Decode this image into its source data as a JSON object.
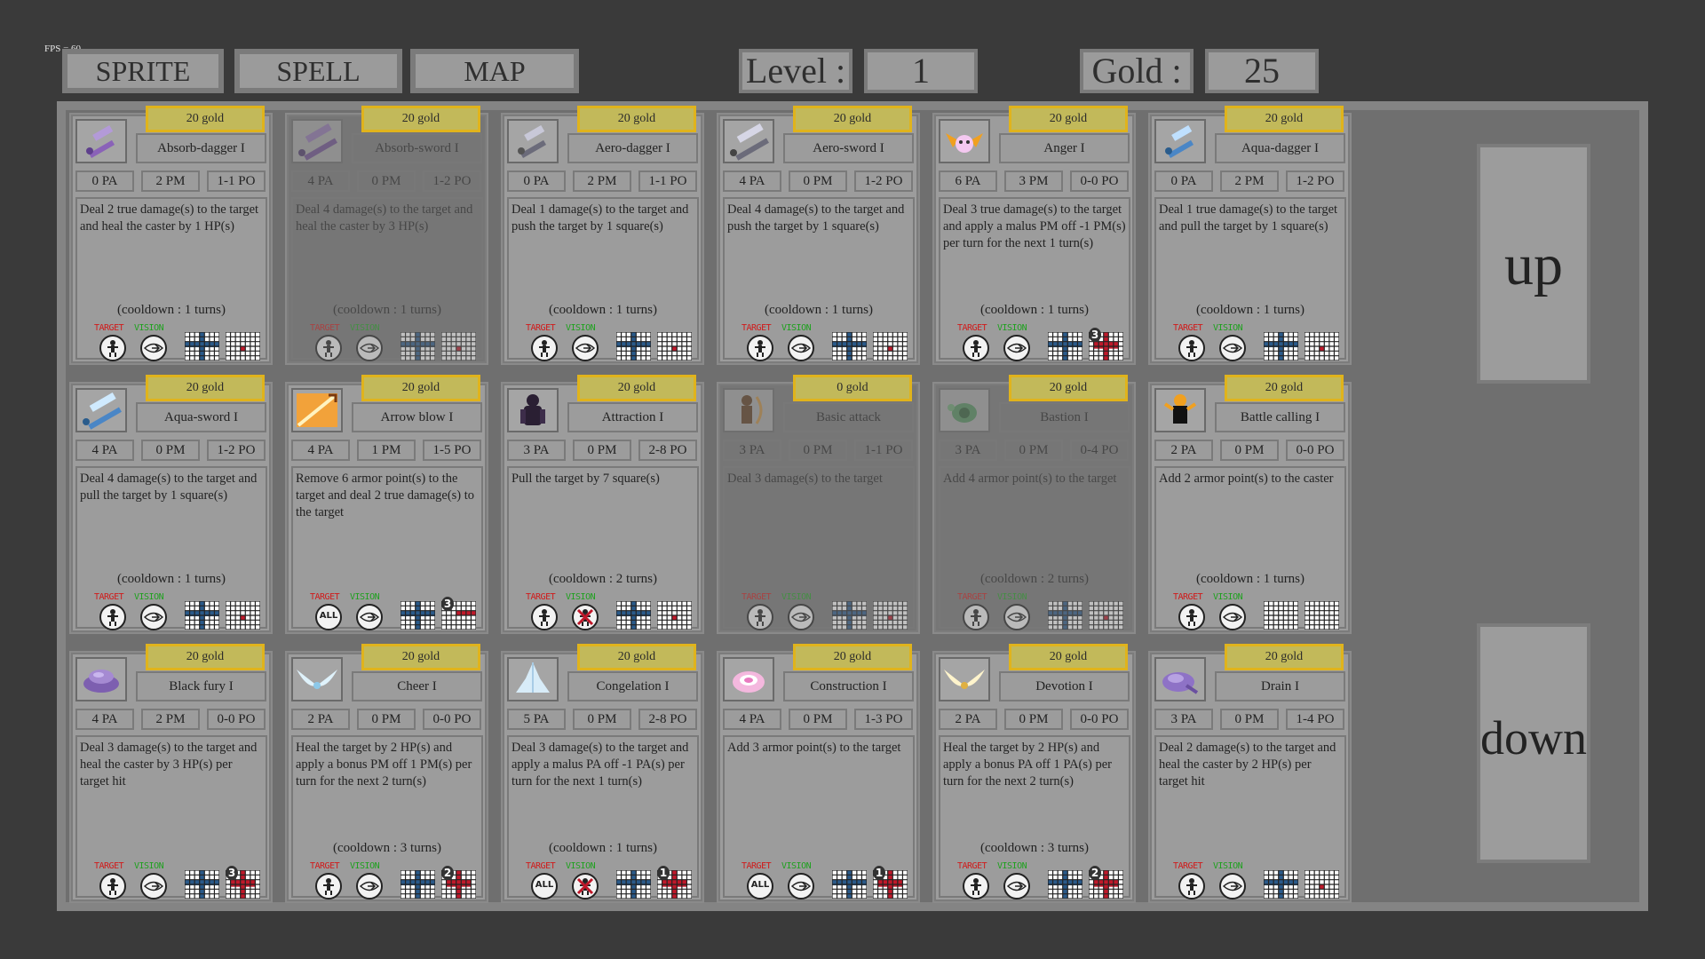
{
  "fps": "FPS = 60",
  "nav": {
    "sprite": "SPRITE",
    "spell": "SPELL",
    "map": "MAP"
  },
  "level": {
    "label": "Level :",
    "value": "1"
  },
  "gold": {
    "label": "Gold :",
    "value": "25"
  },
  "scroll": {
    "up": "up",
    "down": "down"
  },
  "labels": {
    "target": "TARGET",
    "vision": "VISION"
  },
  "spells": [
    {
      "name": "Absorb-dagger I",
      "price": "20 gold",
      "pa": "0 PA",
      "pm": "2 PM",
      "po": "1-1 PO",
      "desc": "Deal 2 true damage(s) to the target and heal the caster by 1 HP(s)",
      "cooldown": "(cooldown : 1 turns)",
      "disabled": false,
      "icon": "dagger-purple-icon",
      "target": "person",
      "vision": "eye",
      "area": "single",
      "badge": ""
    },
    {
      "name": "Absorb-sword I",
      "price": "20 gold",
      "pa": "4 PA",
      "pm": "0 PM",
      "po": "1-2 PO",
      "desc": "Deal 4 damage(s) to the target and heal the caster by 3 HP(s)",
      "cooldown": "(cooldown : 1 turns)",
      "disabled": true,
      "icon": "sword-purple-icon",
      "target": "person",
      "vision": "eye",
      "area": "single",
      "badge": ""
    },
    {
      "name": "Aero-dagger I",
      "price": "20 gold",
      "pa": "0 PA",
      "pm": "2 PM",
      "po": "1-1 PO",
      "desc": "Deal 1 damage(s) to the target and push the target by 1 square(s)",
      "cooldown": "(cooldown : 1 turns)",
      "disabled": false,
      "icon": "dagger-grey-icon",
      "target": "person",
      "vision": "eye",
      "area": "single",
      "badge": ""
    },
    {
      "name": "Aero-sword I",
      "price": "20 gold",
      "pa": "4 PA",
      "pm": "0 PM",
      "po": "1-2 PO",
      "desc": "Deal 4 damage(s) to the target and push the target by 1 square(s)",
      "cooldown": "(cooldown : 1 turns)",
      "disabled": false,
      "icon": "sword-grey-icon",
      "target": "person",
      "vision": "eye",
      "area": "single",
      "badge": ""
    },
    {
      "name": "Anger I",
      "price": "20 gold",
      "pa": "6 PA",
      "pm": "3 PM",
      "po": "0-0 PO",
      "desc": "Deal 3 true damage(s) to the target and apply a malus PM off -1 PM(s) per turn for the next 1 turn(s)",
      "cooldown": "(cooldown : 1 turns)",
      "disabled": false,
      "icon": "winged-skull-icon",
      "target": "person",
      "vision": "eye",
      "area": "cross",
      "badge": "3"
    },
    {
      "name": "Aqua-dagger I",
      "price": "20 gold",
      "pa": "0 PA",
      "pm": "2 PM",
      "po": "1-2 PO",
      "desc": "Deal 1 true damage(s) to the target and pull the target by 1 square(s)",
      "cooldown": "(cooldown : 1 turns)",
      "disabled": false,
      "icon": "dagger-blue-icon",
      "target": "person",
      "vision": "eye",
      "area": "single",
      "badge": ""
    },
    {
      "name": "Aqua-sword I",
      "price": "20 gold",
      "pa": "4 PA",
      "pm": "0 PM",
      "po": "1-2 PO",
      "desc": "Deal 4 damage(s) to the target and pull the target by 1 square(s)",
      "cooldown": "(cooldown : 1 turns)",
      "disabled": false,
      "icon": "sword-blue-icon",
      "target": "person",
      "vision": "eye",
      "area": "single",
      "badge": ""
    },
    {
      "name": "Arrow blow I",
      "price": "20 gold",
      "pa": "4 PA",
      "pm": "1 PM",
      "po": "1-5 PO",
      "desc": "Remove 6 armor point(s) to the target and deal 2 true damage(s) to the target",
      "cooldown": "",
      "disabled": false,
      "icon": "arrow-burst-icon",
      "target": "all",
      "vision": "eye",
      "area": "line",
      "badge": "3"
    },
    {
      "name": "Attraction I",
      "price": "20 gold",
      "pa": "3 PA",
      "pm": "0 PM",
      "po": "2-8 PO",
      "desc": "Pull the target by 7 square(s)",
      "cooldown": "(cooldown : 2 turns)",
      "disabled": false,
      "icon": "shadow-figure-icon",
      "target": "person",
      "vision": "no",
      "area": "single",
      "badge": ""
    },
    {
      "name": "Basic attack",
      "price": "0 gold",
      "pa": "3 PA",
      "pm": "0 PM",
      "po": "1-1 PO",
      "desc": "Deal 3 damage(s) to the target",
      "cooldown": "",
      "disabled": true,
      "icon": "archer-icon",
      "target": "person",
      "vision": "eye",
      "area": "single",
      "badge": ""
    },
    {
      "name": "Bastion I",
      "price": "20 gold",
      "pa": "3 PA",
      "pm": "0 PM",
      "po": "0-4 PO",
      "desc": "Add 4 armor point(s) to the target",
      "cooldown": "(cooldown : 2 turns)",
      "disabled": true,
      "icon": "turtle-icon",
      "target": "person",
      "vision": "eye",
      "area": "single",
      "badge": ""
    },
    {
      "name": "Battle calling I",
      "price": "20 gold",
      "pa": "2 PA",
      "pm": "0 PM",
      "po": "0-0 PO",
      "desc": "Add 2 armor point(s) to the caster",
      "cooldown": "(cooldown : 1 turns)",
      "disabled": false,
      "icon": "battle-cry-icon",
      "target": "person",
      "vision": "eye",
      "area": "none",
      "badge": ""
    },
    {
      "name": "Black fury I",
      "price": "20 gold",
      "pa": "4 PA",
      "pm": "2 PM",
      "po": "0-0 PO",
      "desc": "Deal 3 damage(s) to the target and heal the caster by 3 HP(s) per target hit",
      "cooldown": "",
      "disabled": false,
      "icon": "purple-swirl-icon",
      "target": "person",
      "vision": "eye",
      "area": "cross",
      "badge": "3"
    },
    {
      "name": "Cheer I",
      "price": "20 gold",
      "pa": "2 PA",
      "pm": "0 PM",
      "po": "0-0 PO",
      "desc": "Heal the target by 2 HP(s) and apply a bonus PM off 1 PM(s) per turn for the next 2 turn(s)",
      "cooldown": "(cooldown : 3 turns)",
      "disabled": false,
      "icon": "white-wings-icon",
      "target": "person",
      "vision": "eye",
      "area": "cross",
      "badge": "2"
    },
    {
      "name": "Congelation I",
      "price": "20 gold",
      "pa": "5 PA",
      "pm": "0 PM",
      "po": "2-8 PO",
      "desc": "Deal 3 damage(s) to the target and apply a malus PA off -1 PA(s) per turn for the next 1 turn(s)",
      "cooldown": "(cooldown : 1 turns)",
      "disabled": false,
      "icon": "ice-crystal-icon",
      "target": "all",
      "vision": "no",
      "area": "cross",
      "badge": "1"
    },
    {
      "name": "Construction I",
      "price": "20 gold",
      "pa": "4 PA",
      "pm": "0 PM",
      "po": "1-3 PO",
      "desc": "Add 3 armor point(s) to the target",
      "cooldown": "",
      "disabled": false,
      "icon": "pink-swirl-icon",
      "target": "all",
      "vision": "eye",
      "area": "cross",
      "badge": "1"
    },
    {
      "name": "Devotion I",
      "price": "20 gold",
      "pa": "2 PA",
      "pm": "0 PM",
      "po": "0-0 PO",
      "desc": "Heal the target by 2 HP(s) and apply a bonus PA off 1 PA(s) per turn for the next 2 turn(s)",
      "cooldown": "(cooldown : 3 turns)",
      "disabled": false,
      "icon": "golden-wings-icon",
      "target": "person",
      "vision": "eye",
      "area": "cross",
      "badge": "2"
    },
    {
      "name": "Drain I",
      "price": "20 gold",
      "pa": "3 PA",
      "pm": "0 PM",
      "po": "1-4 PO",
      "desc": "Deal 2 damage(s) to the target and heal the caster by 2 HP(s) per target hit",
      "cooldown": "",
      "disabled": false,
      "icon": "purple-drain-icon",
      "target": "person",
      "vision": "eye",
      "area": "single",
      "badge": ""
    }
  ]
}
